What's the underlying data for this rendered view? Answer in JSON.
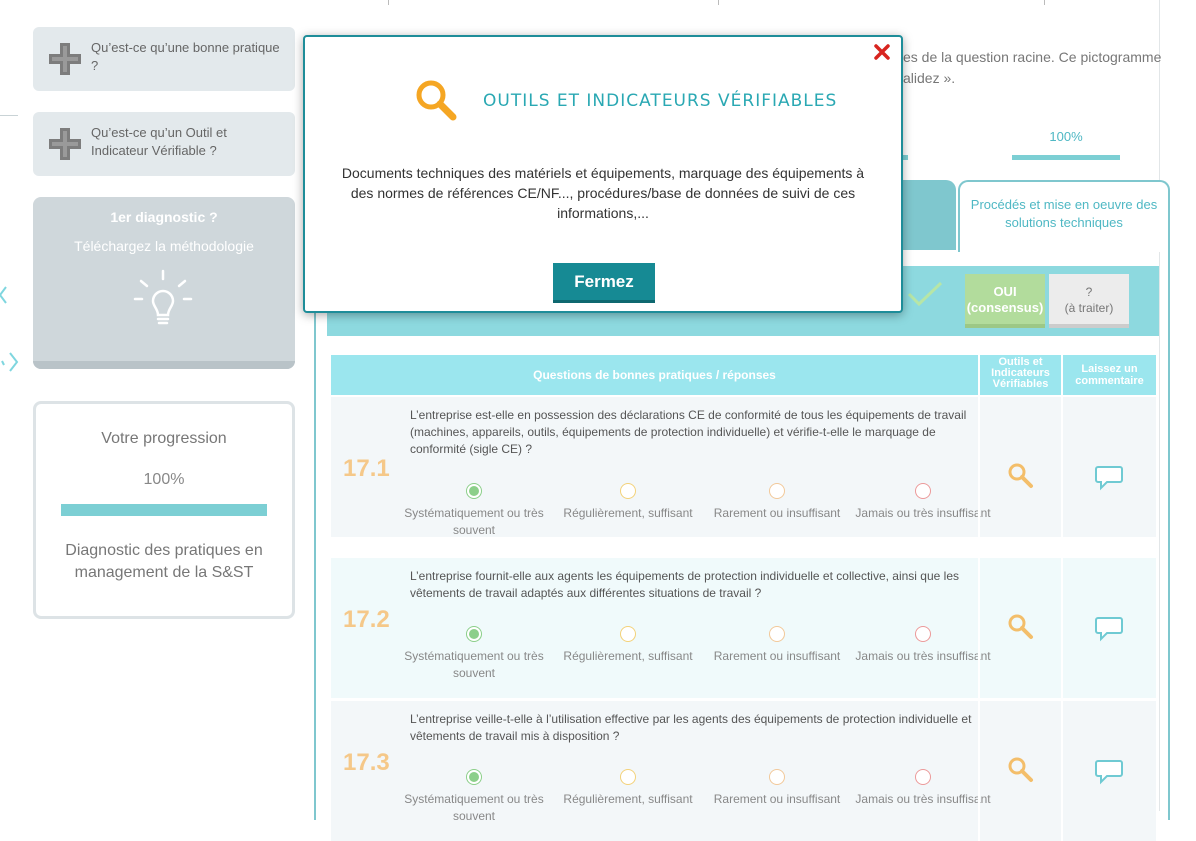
{
  "sidebar": {
    "help_items": [
      {
        "label": "Qu’est-ce qu’une bonne pratique ?"
      },
      {
        "label": "Qu’est-ce qu’un Outil et Indicateur Vérifiable ?"
      }
    ],
    "diagnostic": {
      "title": "1er diagnostic ?",
      "link": "Téléchargez la méthodologie"
    },
    "progression": {
      "title": "Votre progression",
      "percent_label": "100%",
      "percent_value": 100,
      "description": "Diagnostic des pratiques en management de la S&ST"
    }
  },
  "main": {
    "intro_line1": "es de la question racine. Ce pictogramme",
    "intro_line2": "alidez ».",
    "progress_label": "100%",
    "tabs": [
      {
        "label": ""
      },
      {
        "label": "Procédés et mise en oeuvre des solutions techniques"
      }
    ],
    "answer_buttons": {
      "oui": {
        "line1": "OUI",
        "line2": "(consensus)"
      },
      "unknown": {
        "line1": "?",
        "line2": "(à traiter)"
      }
    },
    "table_headers": {
      "questions": "Questions de bonnes pratiques / réponses",
      "tools": "Outils et Indicateurs Vérifiables",
      "comment": "Laissez un commentaire"
    },
    "options": [
      "Systématiquement ou très souvent",
      "Régulièrement, suffisant",
      "Rarement ou insuffisant",
      "Jamais ou très insuffisant"
    ],
    "questions": [
      {
        "number": "17.1",
        "text": "L’entreprise est-elle en possession des déclarations CE de conformité de tous les équipements de travail (machines, appareils, outils, équipements de protection individuelle) et vérifie-t-elle le marquage de conformité (sigle CE) ?",
        "selected": 0
      },
      {
        "number": "17.2",
        "text": "L’entreprise fournit-elle aux agents les équipements de protection individuelle et collective, ainsi que les vêtements de travail adaptés aux différentes situations de travail ?",
        "selected": 0
      },
      {
        "number": "17.3",
        "text": "L’entreprise veille-t-elle à l’utilisation effective par les agents des équipements de protection individuelle et vêtements de travail mis à disposition ?",
        "selected": 0
      }
    ]
  },
  "modal": {
    "title": "OUTILS ET INDICATEURS VÉRIFIABLES",
    "body": "Documents techniques des matériels et équipements, marquage des équipements à des normes de références CE/NF..., procédures/base de données de suivi de ces informations,...",
    "close_button": "Fermez",
    "icons": {
      "close": "close-x-icon",
      "title": "magnifier-icon"
    }
  },
  "colors": {
    "accent": "#2aa8b3",
    "button": "#168a94",
    "header": "#9be6ee",
    "number": "#f5c889",
    "yes": "#b2dc9c"
  }
}
